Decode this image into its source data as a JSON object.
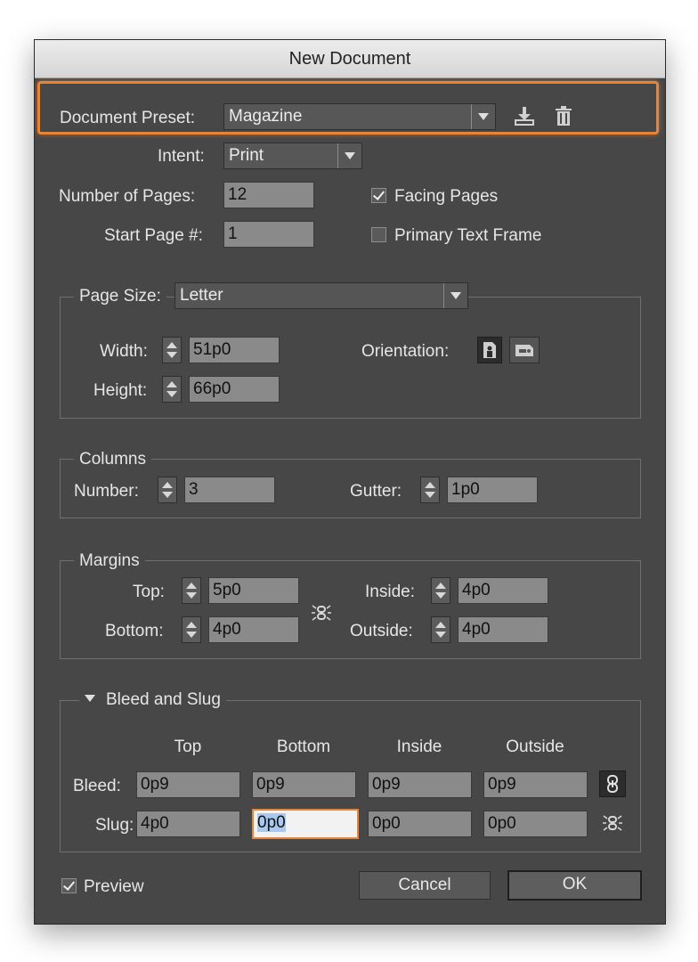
{
  "dialog": {
    "title": "New Document"
  },
  "preset": {
    "label": "Document Preset:",
    "value": "Magazine",
    "save_icon": "save-preset-icon",
    "delete_icon": "trash-icon",
    "highlight_color": "#e8833a"
  },
  "intent": {
    "label": "Intent:",
    "value": "Print"
  },
  "pages": {
    "label": "Number of Pages:",
    "value": "12"
  },
  "start_page": {
    "label": "Start Page #:",
    "value": "1"
  },
  "facing_pages": {
    "label": "Facing Pages",
    "checked": true
  },
  "primary_text_frame": {
    "label": "Primary Text Frame",
    "checked": false
  },
  "page_size": {
    "label": "Page Size:",
    "value": "Letter",
    "width_label": "Width:",
    "width": "51p0",
    "height_label": "Height:",
    "height": "66p0",
    "orientation_label": "Orientation:",
    "orientation_options": [
      "portrait",
      "landscape"
    ],
    "orientation_selected": "portrait"
  },
  "columns": {
    "legend": "Columns",
    "number_label": "Number:",
    "number": "3",
    "gutter_label": "Gutter:",
    "gutter": "1p0"
  },
  "margins": {
    "legend": "Margins",
    "top_label": "Top:",
    "top": "5p0",
    "bottom_label": "Bottom:",
    "bottom": "4p0",
    "inside_label": "Inside:",
    "inside": "4p0",
    "outside_label": "Outside:",
    "outside": "4p0",
    "link_icon": "unlinked-chain-icon"
  },
  "bleed_slug": {
    "legend": "Bleed and Slug",
    "col_headers": [
      "Top",
      "Bottom",
      "Inside",
      "Outside"
    ],
    "bleed_label": "Bleed:",
    "bleed": [
      "0p9",
      "0p9",
      "0p9",
      "0p9"
    ],
    "slug_label": "Slug:",
    "slug": [
      "4p0",
      "0p0",
      "0p0",
      "0p0"
    ],
    "focused_field": "slug-bottom",
    "focus_color": "#e8833a"
  },
  "preview": {
    "label": "Preview",
    "checked": true
  },
  "buttons": {
    "cancel": "Cancel",
    "ok": "OK"
  }
}
